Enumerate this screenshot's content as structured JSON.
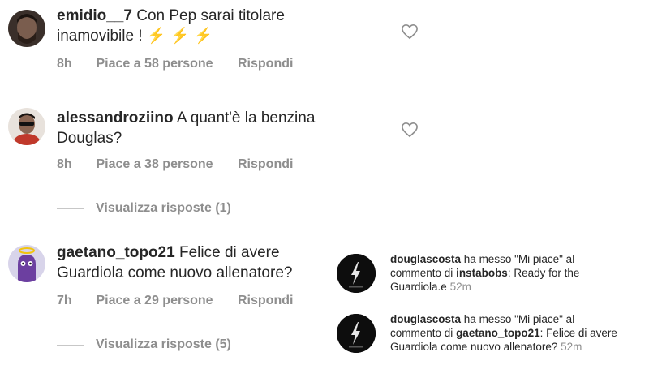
{
  "comments": [
    {
      "username": "emidio__7",
      "text_line1": "Con Pep sarai titolare",
      "text_line2": "inamovibile !",
      "emoji": "⚡ ⚡ ⚡",
      "time": "8h",
      "likes": "Piace a 58 persone",
      "reply": "Rispondi"
    },
    {
      "username": "alessandroziino",
      "text_line1": "A quant'è la benzina",
      "text_line2": "Douglas?",
      "time": "8h",
      "likes": "Piace a 38 persone",
      "reply": "Rispondi",
      "view_replies": "Visualizza risposte (1)"
    },
    {
      "username": "gaetano_topo21",
      "text_line1": "Felice di avere",
      "text_line2": "Guardiola come nuovo allenatore?",
      "time": "7h",
      "likes": "Piace a 29 persone",
      "reply": "Rispondi",
      "view_replies": "Visualizza risposte (5)"
    }
  ],
  "notifications": [
    {
      "username": "douglascosta",
      "action": "ha messo \"Mi piace\" al",
      "line2_prefix": "commento di",
      "target_user": "instabobs",
      "line2_text": ": Ready for the",
      "line3_text": "Guardiola.e",
      "time": "52m"
    },
    {
      "username": "douglascosta",
      "action": "ha messo \"Mi piace\" al",
      "line2_prefix": "commento di",
      "target_user": "gaetano_topo21",
      "line2_text": ": Felice di avere",
      "line3_text": "Guardiola come nuovo allenatore?",
      "time": "52m"
    }
  ],
  "colors": {
    "text": "#262626",
    "muted": "#8e8e8e",
    "emoji_bolt": "#f1c40f",
    "notif_avatar": "#0d0d0d"
  }
}
